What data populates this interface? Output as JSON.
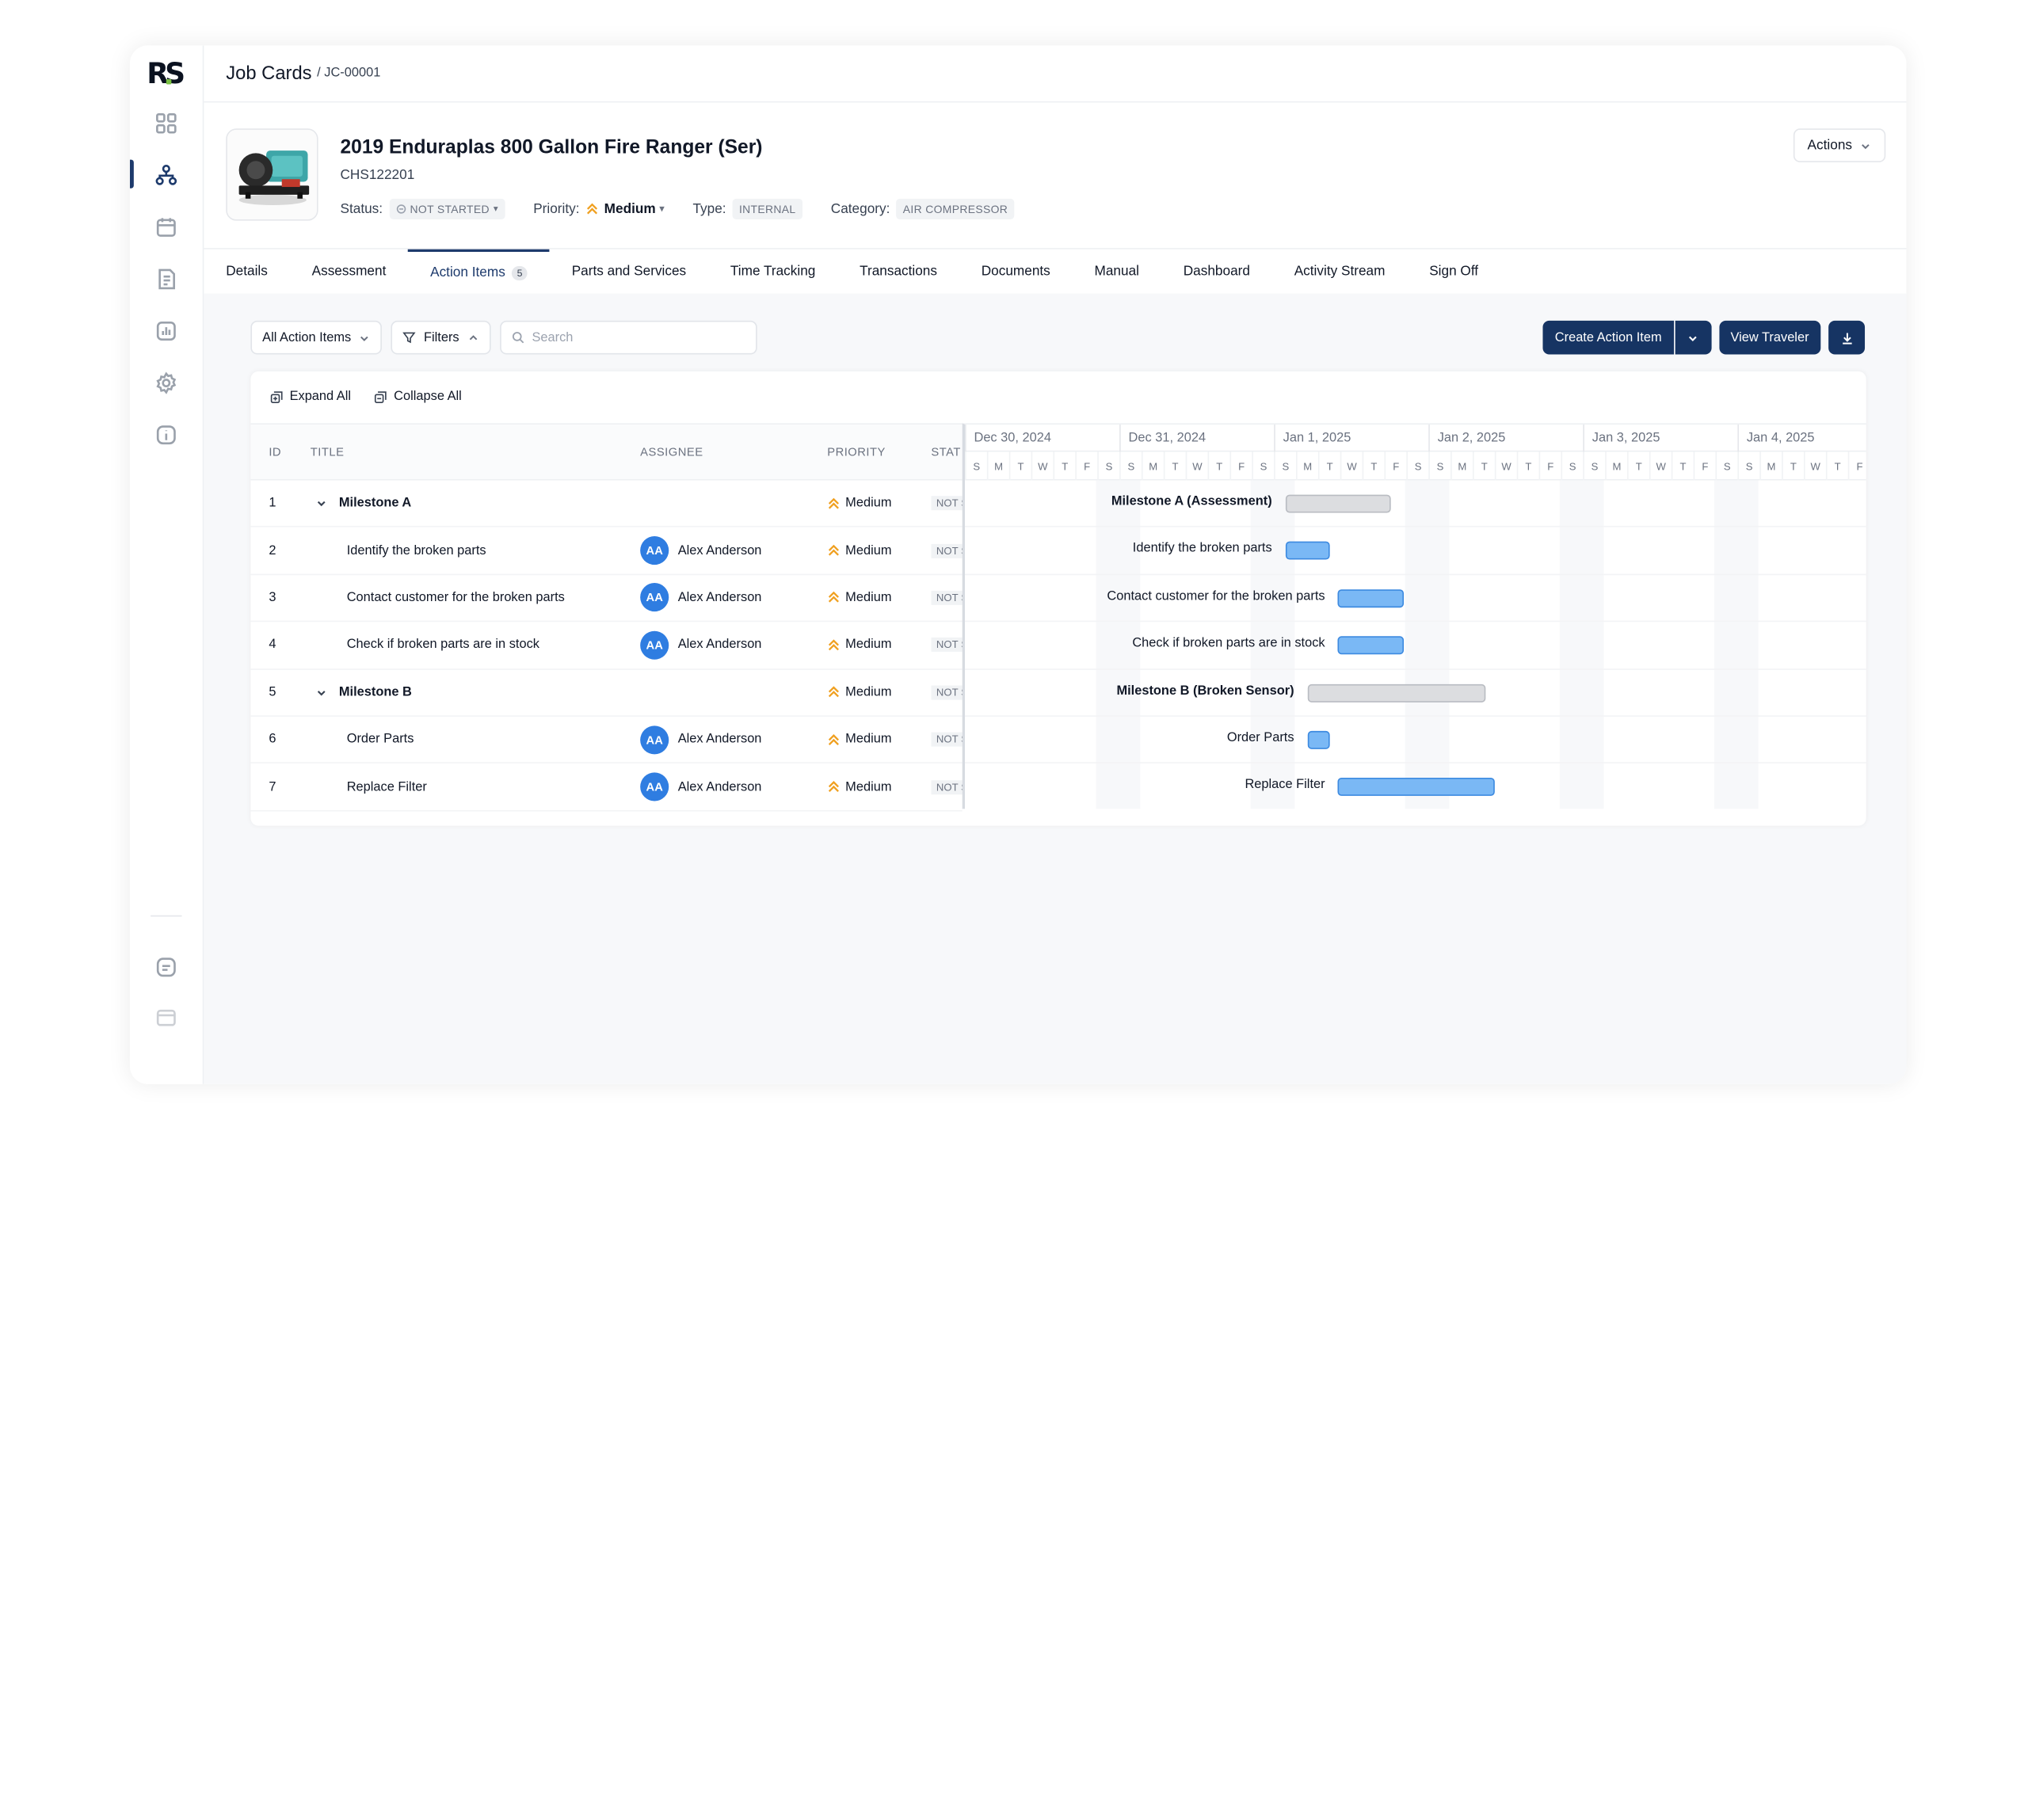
{
  "app": {
    "breadcrumb_title": "Job Cards",
    "breadcrumb_sub": "/ JC-00001"
  },
  "asset": {
    "title": "2019 Enduraplas 800 Gallon Fire Ranger (Ser)",
    "serial": "CHS122201",
    "status_label": "Status:",
    "status": "NOT STARTED",
    "priority_label": "Priority:",
    "priority": "Medium",
    "type_label": "Type:",
    "type": "INTERNAL",
    "category_label": "Category:",
    "category": "AIR COMPRESSOR",
    "actions_label": "Actions"
  },
  "tabs": [
    {
      "label": "Details"
    },
    {
      "label": "Assessment"
    },
    {
      "label": "Action Items",
      "badge": "5"
    },
    {
      "label": "Parts and Services"
    },
    {
      "label": "Time Tracking"
    },
    {
      "label": "Transactions"
    },
    {
      "label": "Documents"
    },
    {
      "label": "Manual"
    },
    {
      "label": "Dashboard"
    },
    {
      "label": "Activity Stream"
    },
    {
      "label": "Sign Off"
    }
  ],
  "toolbar": {
    "view_select": "All Action Items",
    "filters": "Filters",
    "search_placeholder": "Search",
    "create": "Create Action Item",
    "traveler": "View Traveler",
    "expand_all": "Expand All",
    "collapse_all": "Collapse All"
  },
  "grid": {
    "headers": {
      "id": "ID",
      "title": "TITLE",
      "assignee": "ASSIGNEE",
      "priority": "PRIORITY",
      "status": "STAT"
    },
    "rows": [
      {
        "id": "1",
        "title": "Milestone A",
        "milestone": true,
        "assignee": "",
        "initials": "",
        "priority": "Medium",
        "status": "NOT STARTED",
        "gantt_label": "Milestone A (Assessment)",
        "start": 14.5,
        "end": 19.3
      },
      {
        "id": "2",
        "title": "Identify the broken parts",
        "milestone": false,
        "assignee": "Alex Anderson",
        "initials": "AA",
        "priority": "Medium",
        "status": "NOT STARTED",
        "gantt_label": "Identify the broken parts",
        "start": 14.5,
        "end": 16.5
      },
      {
        "id": "3",
        "title": "Contact customer for the broken parts",
        "milestone": false,
        "assignee": "Alex Anderson",
        "initials": "AA",
        "priority": "Medium",
        "status": "NOT STARTED",
        "gantt_label": "Contact customer for the broken parts",
        "start": 16.9,
        "end": 19.9
      },
      {
        "id": "4",
        "title": "Check if broken parts are in stock",
        "milestone": false,
        "assignee": "Alex Anderson",
        "initials": "AA",
        "priority": "Medium",
        "status": "NOT STARTED",
        "gantt_label": "Check if broken parts are in stock",
        "start": 16.9,
        "end": 19.9
      },
      {
        "id": "5",
        "title": "Milestone B",
        "milestone": true,
        "assignee": "",
        "initials": "",
        "priority": "Medium",
        "status": "NOT STARTED",
        "gantt_label": "Milestone B (Broken Sensor)",
        "start": 15.5,
        "end": 23.6
      },
      {
        "id": "6",
        "title": "Order Parts",
        "milestone": false,
        "assignee": "Alex Anderson",
        "initials": "AA",
        "priority": "Medium",
        "status": "NOT STARTED",
        "gantt_label": "Order Parts",
        "start": 15.5,
        "end": 16.5
      },
      {
        "id": "7",
        "title": "Replace Filter",
        "milestone": false,
        "assignee": "Alex Anderson",
        "initials": "AA",
        "priority": "Medium",
        "status": "NOT STARTED",
        "gantt_label": "Replace Filter",
        "start": 16.9,
        "end": 24.0
      }
    ]
  },
  "timeline": {
    "dates": [
      "Dec 30, 2024",
      "Dec 31, 2024",
      "Jan 1, 2025",
      "Jan 2, 2025",
      "Jan 3, 2025",
      "Jan 4, 2025"
    ],
    "days": [
      "S",
      "M",
      "T",
      "W",
      "T",
      "F",
      "S"
    ]
  },
  "colors": {
    "primary": "#163463",
    "accent": "#2f7de1",
    "priority": "#f0a020",
    "task_bar": "#7ab8f5",
    "milestone_bar": "#dcdde0"
  }
}
